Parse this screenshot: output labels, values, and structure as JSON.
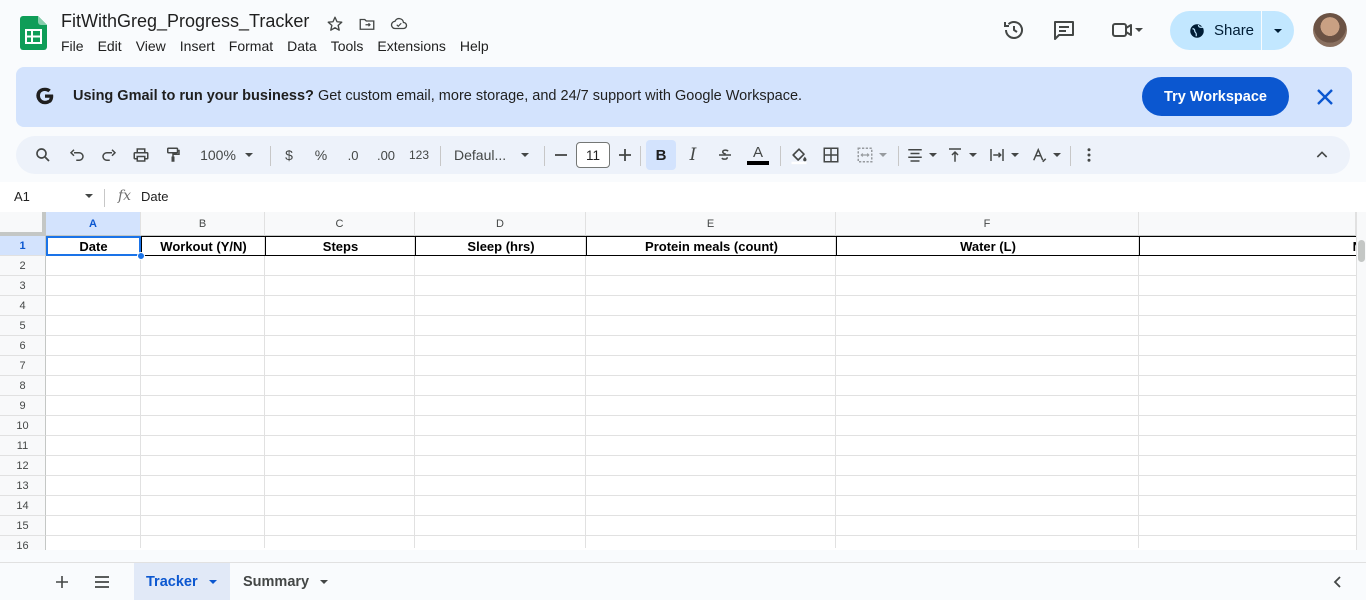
{
  "app": {
    "doc_title": "FitWithGreg_Progress_Tracker",
    "menus": [
      "File",
      "Edit",
      "View",
      "Insert",
      "Format",
      "Data",
      "Tools",
      "Extensions",
      "Help"
    ],
    "share_label": "Share",
    "accent_color": "#0b57d0"
  },
  "banner": {
    "bold_text": "Using Gmail to run your business?",
    "text": "Get custom email, more storage, and 24/7 support with Google Workspace.",
    "button_label": "Try Workspace"
  },
  "toolbar": {
    "zoom": "100%",
    "currency": "$",
    "percent": "%",
    "dec_decrease": ".0",
    "dec_increase": ".00",
    "more_formats": "123",
    "font": "Defaul...",
    "font_size": "11",
    "bold": "B",
    "italic": "I",
    "text_color": "A"
  },
  "formula_bar": {
    "cell_ref": "A1",
    "fx": "fx",
    "content": "Date"
  },
  "grid": {
    "columns": [
      "A",
      "B",
      "C",
      "D",
      "E",
      "F"
    ],
    "rows": [
      "1",
      "2",
      "3",
      "4",
      "5",
      "6",
      "7",
      "8",
      "9",
      "10",
      "11",
      "12",
      "13",
      "14",
      "15",
      "16"
    ],
    "header_row": [
      "Date",
      "Workout (Y/N)",
      "Steps",
      "Sleep (hrs)",
      "Protein meals (count)",
      "Water (L)",
      "N"
    ]
  },
  "sheets": {
    "tabs": [
      "Tracker",
      "Summary"
    ],
    "active": "Tracker"
  }
}
